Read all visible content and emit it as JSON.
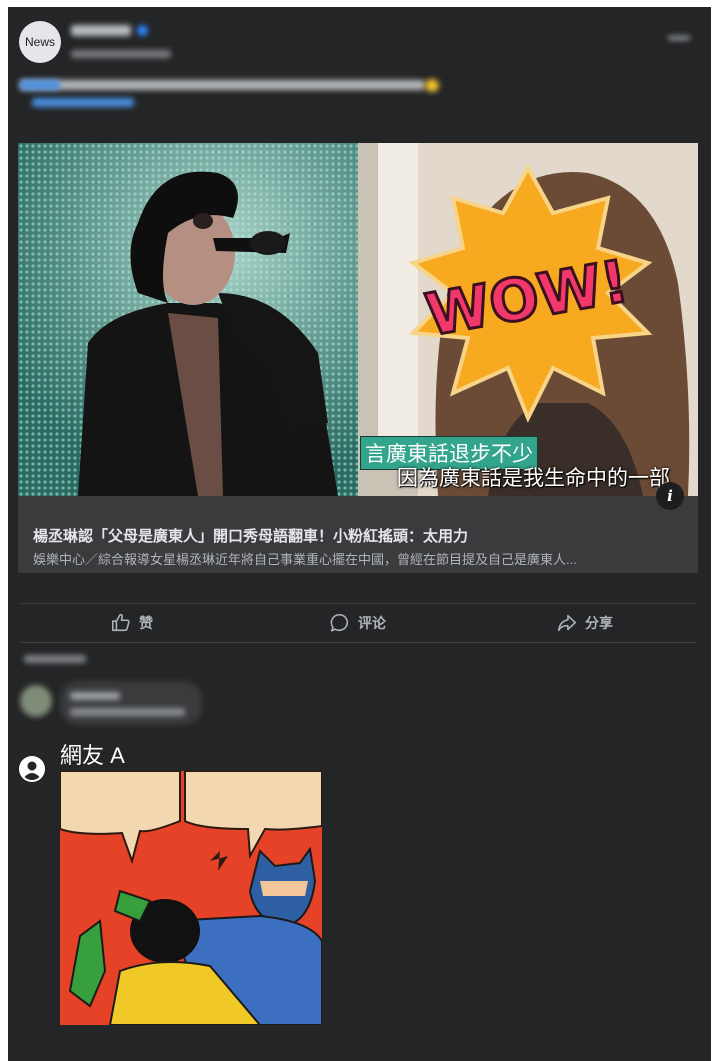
{
  "post": {
    "avatar_text": "News",
    "link_preview": {
      "subtitle_line_1": "言廣東話退步不少",
      "subtitle_line_2": "因為廣東話是我生命中的一部",
      "sticker_text": "WOW!",
      "info_icon": "i",
      "title": "楊丞琳認「父母是廣東人」開口秀母語翻車！小粉紅搖頭：太用力",
      "description": "娛樂中心／綜合報導女星楊丞琳近年將自己事業重心擺在中國，曾經在節目提及自己是廣東人..."
    },
    "actions": [
      {
        "label": "赞",
        "icon": "thumbs-up-icon"
      },
      {
        "label": "评论",
        "icon": "comment-icon"
      },
      {
        "label": "分享",
        "icon": "share-icon"
      }
    ]
  },
  "reply": {
    "user_name": "網友 A",
    "user_icon": "user-circle-icon"
  },
  "colors": {
    "card_bg": "#242526",
    "text_primary": "#e4e6eb",
    "text_secondary": "#b0b3b8",
    "link_blue": "#4a8fe0"
  }
}
